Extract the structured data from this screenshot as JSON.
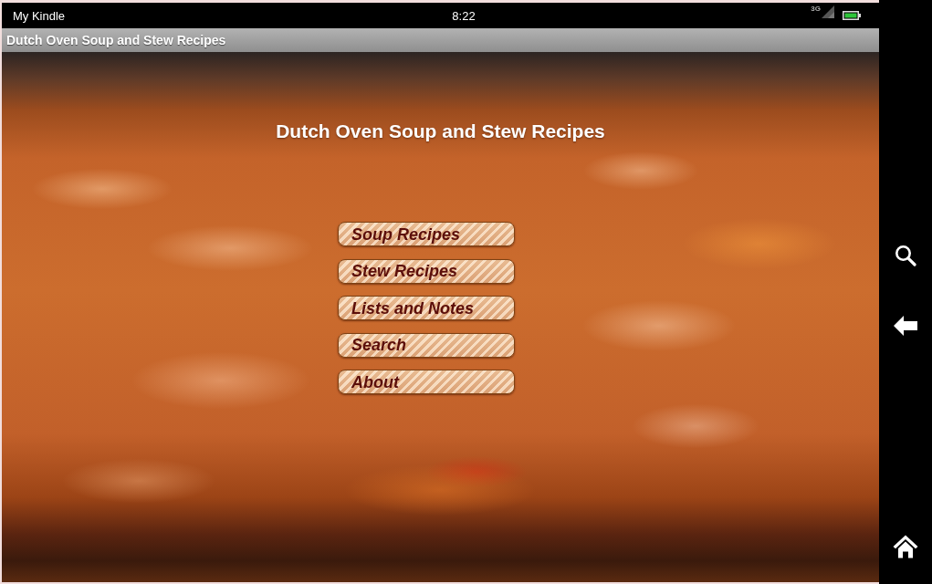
{
  "status_bar": {
    "carrier": "My Kindle",
    "time": "8:22",
    "network": "3G"
  },
  "title_bar": {
    "title": "Dutch Oven Soup and Stew Recipes"
  },
  "main": {
    "heading": "Dutch Oven Soup and Stew Recipes",
    "menu": [
      {
        "label": "Soup Recipes"
      },
      {
        "label": "Stew Recipes"
      },
      {
        "label": "Lists and Notes"
      },
      {
        "label": "Search"
      },
      {
        "label": "About"
      }
    ]
  },
  "nav_bar": {
    "buttons": [
      {
        "kind": "search"
      },
      {
        "kind": "back"
      },
      {
        "kind": "home"
      }
    ]
  }
}
